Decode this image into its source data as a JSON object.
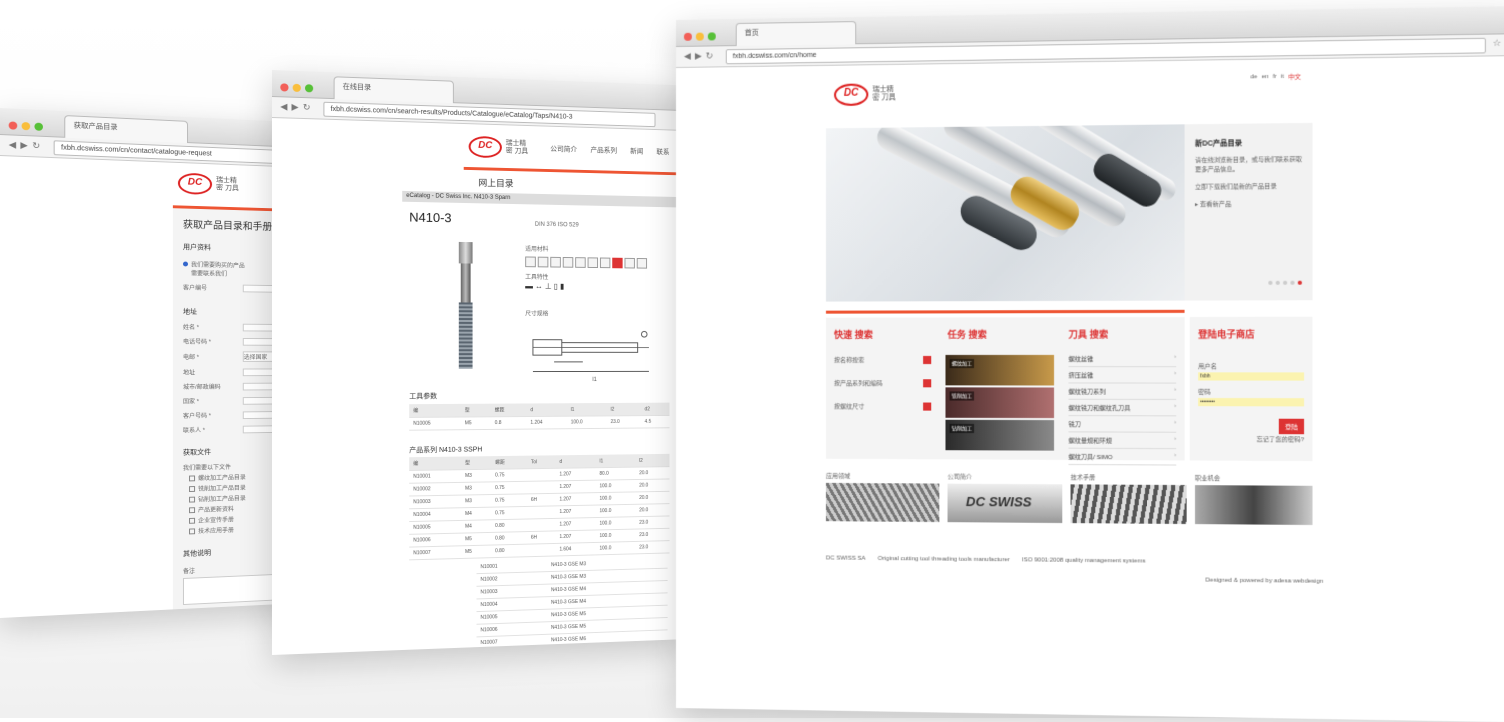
{
  "colors": {
    "accent": "#dd3333",
    "brand_red": "#e55533",
    "window_bg": "#ffffff"
  },
  "left_window": {
    "tab_title": "获取产品目录",
    "url": "fxbh.dcswiss.com/cn/contact/catalogue-request",
    "logo_text": "DC",
    "logo_subtitle": "瑞士精密 刀具",
    "page_title": "获取产品目录和手册",
    "section_user": "用户资料",
    "radio_options": [
      "我们需要购买的产品",
      "需要联系我们"
    ],
    "customer_no_label": "客户编号",
    "section_address": "地址",
    "form_labels": [
      "姓名 *",
      "电话号码 *",
      "电邮 *",
      "地址",
      "城市/邮政编码",
      "国家 *",
      "客户号码 *",
      "联系人 *"
    ],
    "country_value": "选择国家",
    "section_catalogs": "获取文件",
    "catalog_intro": "我们需要以下文件",
    "catalog_items": [
      "螺纹加工产品目录",
      "铣削加工产品目录",
      "钻削加工产品目录",
      "产品更新资料",
      "企业宣传手册",
      "技术应用手册"
    ],
    "section_notes": "其他说明",
    "notes_label": "备注"
  },
  "mid_window": {
    "tab_title": "在线目录",
    "url": "fxbh.dcswiss.com/cn/search-results/Products/Catalogue/eCatalog/Taps/N410-3",
    "logo_text": "DC",
    "logo_subtitle": "瑞士精密 刀具",
    "nav": [
      "公司简介",
      "产品系列",
      "新闻",
      "联系"
    ],
    "section_title": "网上目录",
    "breadcrumb": "eCatalog - DC Swiss Inc. N410-3 Sparn",
    "product_code": "N410-3",
    "side_caption": "DIN 376 ISO 529",
    "label_application": "适用材料",
    "label_tool_data": "工具特性",
    "label_dimension": "尺寸规格",
    "tool_section": "工具参数",
    "tool_table": {
      "headers": [
        "编",
        "型",
        "螺距",
        "d",
        "l1",
        "l2",
        "d2"
      ],
      "rows": [
        [
          "N10005",
          "M5",
          "0.8",
          "1.204",
          "100.0",
          "23.0",
          "4.5"
        ]
      ]
    },
    "series_section": "产品系列 N410-3 SSPH",
    "series_table": {
      "headers": [
        "编",
        "型",
        "螺距",
        "Tol",
        "d",
        "l1",
        "l2"
      ],
      "rows": [
        [
          "N10001",
          "M3",
          "0.75",
          "",
          "1.207",
          "80.0",
          "20.0"
        ],
        [
          "N10002",
          "M3",
          "0.75",
          "",
          "1.207",
          "100.0",
          "20.0"
        ],
        [
          "N10003",
          "M3",
          "0.75",
          "6H",
          "1.207",
          "100.0",
          "20.0"
        ],
        [
          "N10004",
          "M4",
          "0.75",
          "",
          "1.207",
          "100.0",
          "20.0"
        ],
        [
          "N10005",
          "M4",
          "0.80",
          "",
          "1.207",
          "100.0",
          "23.0"
        ],
        [
          "N10006",
          "M5",
          "0.80",
          "6H",
          "1.207",
          "100.0",
          "23.0"
        ],
        [
          "N10007",
          "M5",
          "0.80",
          "",
          "1.604",
          "100.0",
          "23.0"
        ]
      ]
    },
    "extra_rows": [
      [
        "N10001",
        "N410-3 GSE M3"
      ],
      [
        "N10002",
        "N410-3 GSE M3"
      ],
      [
        "N10003",
        "N410-3 GSE M4"
      ],
      [
        "N10004",
        "N410-3 GSE M4"
      ],
      [
        "N10005",
        "N410-3 GSE M5"
      ],
      [
        "N10006",
        "N410-3 GSE M5"
      ],
      [
        "N10007",
        "N410-3 GSE M6"
      ]
    ]
  },
  "right_window": {
    "tab_title": "首页",
    "url": "fxbh.dcswiss.com/cn/home",
    "logo_text": "DC",
    "logo_subtitle": "瑞士精密 刀具",
    "lang_links": [
      "de",
      "en",
      "fr",
      "it",
      "中文"
    ],
    "hero_side_title": "新DC产品目录",
    "hero_side_text": "请在线浏览新目录，或与我们联系获取更多产品信息。",
    "hero_side_text2": "立即下载我们最新的产品目录",
    "hero_side_link": "查看新产品",
    "col1_title": "快速 搜索",
    "col1_items": [
      "按名称搜索",
      "按产品系列和编码",
      "按螺纹尺寸"
    ],
    "col2_title": "任务 搜索",
    "col2_items": [
      "螺纹加工",
      "铣削加工",
      "钻削加工"
    ],
    "col3_title": "刀具 搜索",
    "col3_items": [
      "螺纹丝锥",
      "挤压丝锥",
      "螺纹铣刀系列",
      "螺纹铣刀和螺纹孔刀具",
      "铣刀",
      "螺纹量规和环规",
      "螺纹刀具/ SIMO"
    ],
    "col4_title": "登陆电子商店",
    "login_user_label": "用户名",
    "login_user_value": "fxbh",
    "login_pass_label": "密码",
    "login_pass_value": "••••••••",
    "login_button": "登陆",
    "forgot_link": "忘记了您的密码?",
    "strip_labels": [
      "应用领域",
      "公司简介",
      "技术手册",
      "职业机会"
    ],
    "strip_banner_text": "DC SWISS",
    "footer_items": [
      "DC SWISS SA",
      "Original cutting tool threading tools manufacturer",
      "ISO 9001:2008 quality management systems"
    ],
    "footer_right": "Designed & powered by adesa webdesign"
  }
}
